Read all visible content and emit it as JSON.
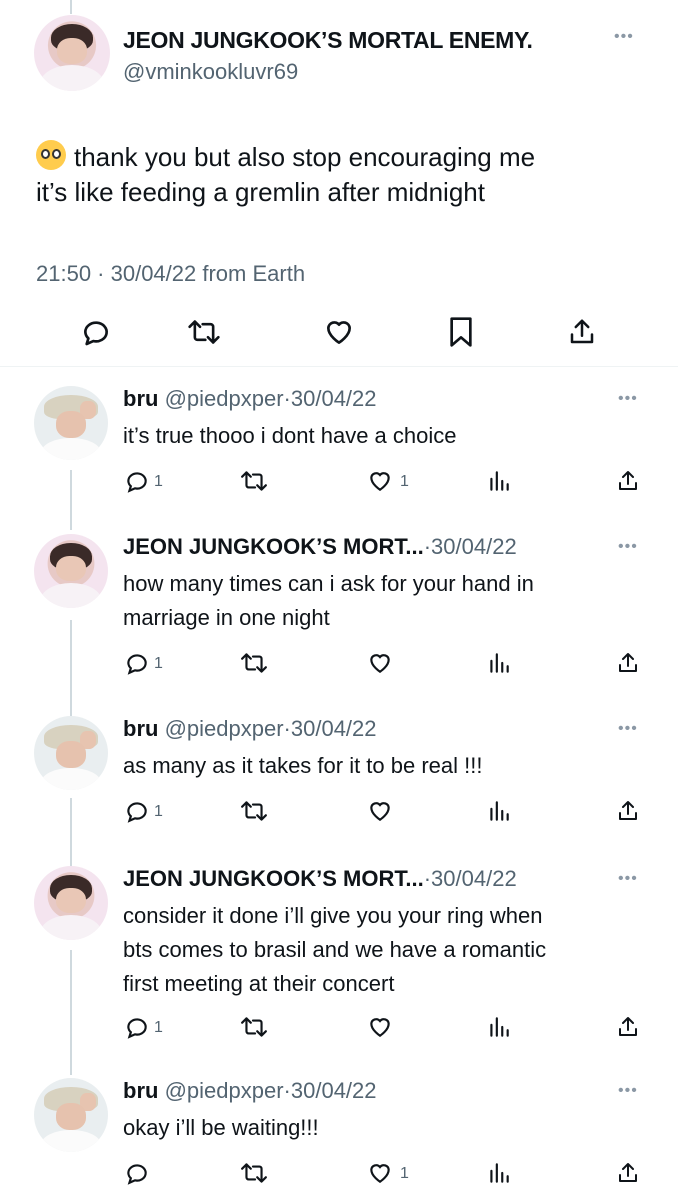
{
  "main_tweet": {
    "display_name": "JEON JUNGKOOK’S MORTAL ENEMY.",
    "handle": "@vminkookluvr69",
    "more_icon": "more-icon",
    "text_line1": "thank you but also stop encouraging me",
    "text_line2": "it’s like feeding a gremlin after midnight",
    "emoji": "pleading-face-emoji",
    "meta": "21:50 · 30/04/22 from Earth",
    "actions": [
      "reply-icon",
      "retweet-icon",
      "like-icon",
      "bookmark-icon",
      "share-icon"
    ]
  },
  "replies": [
    {
      "name": "bru",
      "handle": "@piedpxper",
      "sep": "·",
      "date": "30/04/22",
      "lines": [
        "it’s true thooo i dont have a choice"
      ],
      "reply_count": "1",
      "like_count": "1",
      "avatar": "gray"
    },
    {
      "name": "JEON JUNGKOOK’S MORT...",
      "handle": "",
      "sep": "·",
      "date": "30/04/22",
      "lines": [
        "how many times can i ask for your hand in",
        "marriage in one night"
      ],
      "reply_count": "1",
      "like_count": "",
      "avatar": "pink"
    },
    {
      "name": "bru",
      "handle": "@piedpxper",
      "sep": "·",
      "date": "30/04/22",
      "lines": [
        "as many as it takes for it to be real !!!"
      ],
      "reply_count": "1",
      "like_count": "",
      "avatar": "gray"
    },
    {
      "name": "JEON JUNGKOOK’S MORT...",
      "handle": "",
      "sep": "·",
      "date": "30/04/22",
      "lines": [
        "consider it done i’ll give you your ring when",
        "bts comes to brasil and we have a romantic",
        "first meeting at their concert"
      ],
      "reply_count": "1",
      "like_count": "",
      "avatar": "pink"
    },
    {
      "name": "bru",
      "handle": "@piedpxper",
      "sep": "·",
      "date": "30/04/22",
      "lines": [
        "okay i’ll be waiting!!!"
      ],
      "reply_count": "",
      "like_count": "1",
      "avatar": "gray"
    }
  ],
  "colors": {
    "text": "#0f1419",
    "secondary": "#536471",
    "divider": "#eff3f4",
    "thread_line": "#cfd9de"
  }
}
